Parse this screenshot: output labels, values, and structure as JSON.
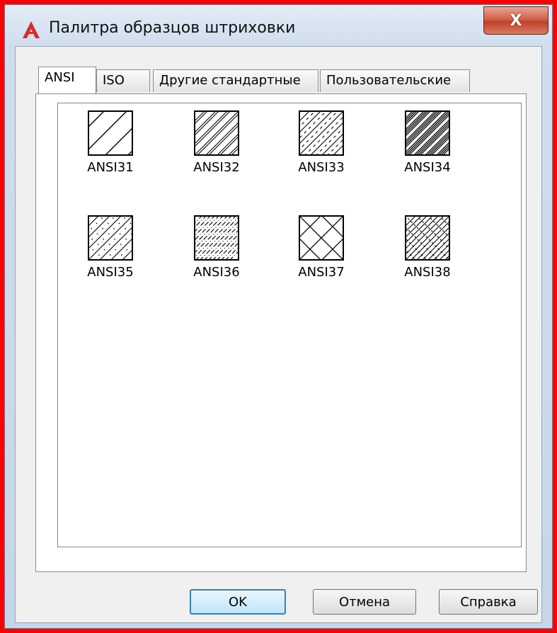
{
  "window": {
    "title": "Палитра образцов штриховки",
    "close_label": "X"
  },
  "tabs": [
    {
      "label": "ANSI",
      "active": true
    },
    {
      "label": "ISO",
      "active": false
    },
    {
      "label": "Другие стандартные",
      "active": false
    },
    {
      "label": "Пользовательские",
      "active": false
    }
  ],
  "patterns": [
    {
      "name": "ANSI31",
      "icon": "hatch-ansi31-icon"
    },
    {
      "name": "ANSI32",
      "icon": "hatch-ansi32-icon"
    },
    {
      "name": "ANSI33",
      "icon": "hatch-ansi33-icon"
    },
    {
      "name": "ANSI34",
      "icon": "hatch-ansi34-icon"
    },
    {
      "name": "ANSI35",
      "icon": "hatch-ansi35-icon"
    },
    {
      "name": "ANSI36",
      "icon": "hatch-ansi36-icon"
    },
    {
      "name": "ANSI37",
      "icon": "hatch-ansi37-icon"
    },
    {
      "name": "ANSI38",
      "icon": "hatch-ansi38-icon"
    }
  ],
  "buttons": {
    "ok": "OK",
    "cancel": "Отмена",
    "help": "Справка"
  },
  "colors": {
    "frame_highlight": "#ff0000",
    "app_icon": "#d32f2f",
    "default_button_border": "#3c7fb1"
  }
}
